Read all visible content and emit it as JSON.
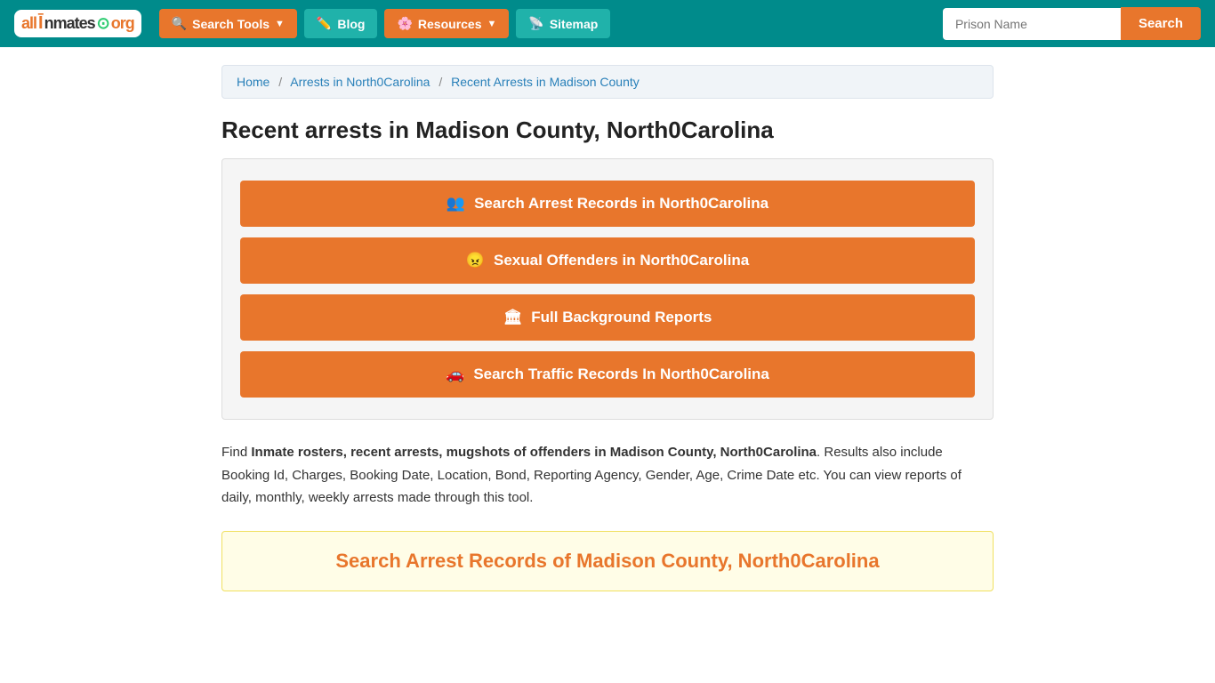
{
  "header": {
    "logo": {
      "text": "allInmates.org"
    },
    "nav": [
      {
        "id": "search-tools",
        "label": "Search Tools",
        "icon": "🔍",
        "hasDropdown": true
      },
      {
        "id": "blog",
        "label": "Blog",
        "icon": "✏️",
        "hasDropdown": false
      },
      {
        "id": "resources",
        "label": "Resources",
        "icon": "🌸",
        "hasDropdown": true
      },
      {
        "id": "sitemap",
        "label": "Sitemap",
        "icon": "📡",
        "hasDropdown": false
      }
    ],
    "search": {
      "placeholder": "Prison Name",
      "button_label": "Search"
    }
  },
  "breadcrumb": {
    "home": "Home",
    "arrests": "Arrests in North0Carolina",
    "current": "Recent Arrests in Madison County"
  },
  "main": {
    "title": "Recent arrests in Madison County, North0Carolina",
    "buttons": [
      {
        "id": "arrest-records",
        "icon": "👥",
        "label": "Search Arrest Records in North0Carolina"
      },
      {
        "id": "sex-offenders",
        "icon": "😠",
        "label": "Sexual Offenders in North0Carolina"
      },
      {
        "id": "background-reports",
        "icon": "🏛",
        "label": "Full Background Reports"
      },
      {
        "id": "traffic-records",
        "icon": "🚗",
        "label": "Search Traffic Records In North0Carolina"
      }
    ],
    "description": {
      "prefix": "Find ",
      "bold_text": "Inmate rosters, recent arrests, mugshots of offenders in Madison County, North0Carolina",
      "suffix": ". Results also include Booking Id, Charges, Booking Date, Location, Bond, Reporting Agency, Gender, Age, Crime Date etc. You can view reports of daily, monthly, weekly arrests made through this tool."
    },
    "bottom_search_title": "Search Arrest Records of Madison County, North0Carolina"
  }
}
